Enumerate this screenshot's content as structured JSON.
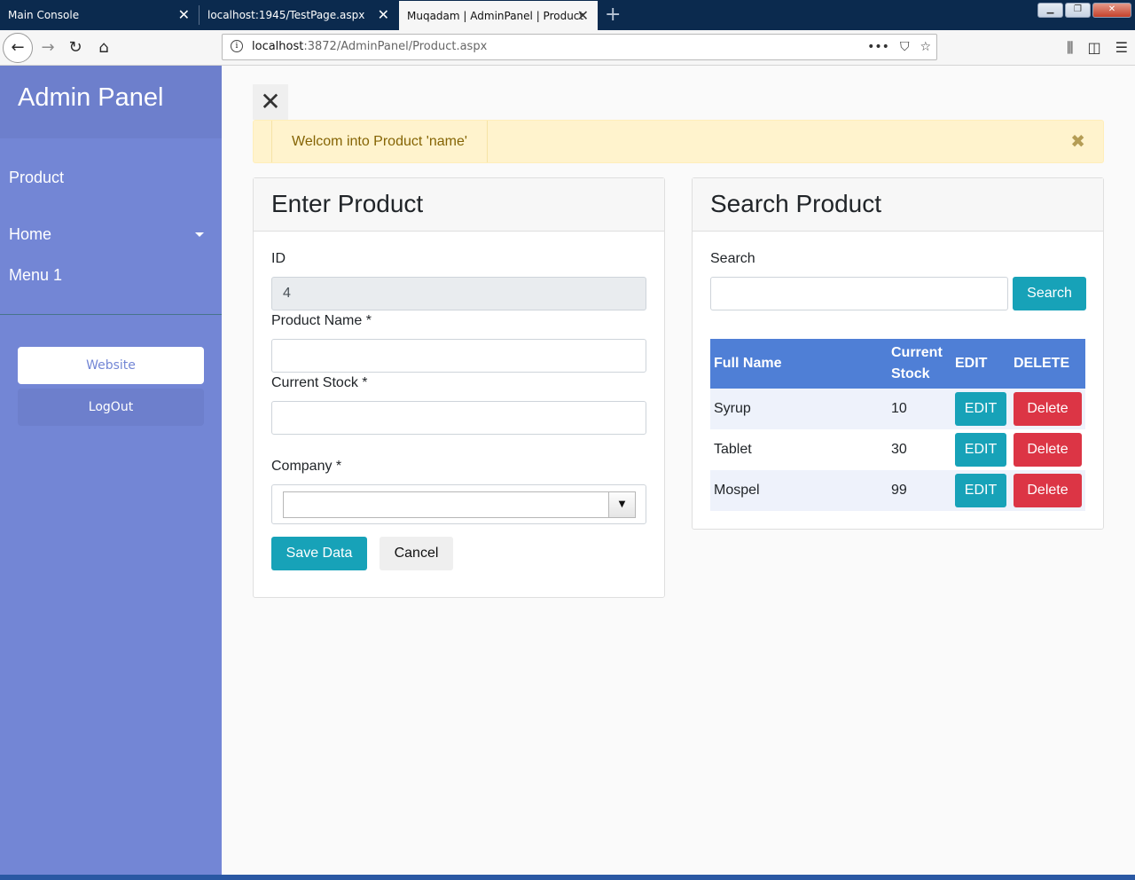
{
  "browser": {
    "tabs": [
      {
        "label": "Main Console"
      },
      {
        "label": "localhost:1945/TestPage.aspx"
      },
      {
        "label": "Muqadam | AdminPanel | Product"
      }
    ],
    "new_tab_icon": "+",
    "url_host": "localhost",
    "url_rest": ":3872/AdminPanel/Product.aspx",
    "url_actions": [
      "•••"
    ]
  },
  "sidebar": {
    "title": "Admin Panel",
    "items": [
      {
        "label": "Product"
      },
      {
        "label": "Home"
      },
      {
        "label": "Menu 1"
      }
    ],
    "website_label": "Website",
    "logout_label": "LogOut"
  },
  "alert": {
    "message": "Welcom into Product 'name'",
    "close_glyph": "✖"
  },
  "enter_product": {
    "title": "Enter Product",
    "id_label": "ID",
    "id_value": "4",
    "product_name_label": "Product Name *",
    "product_name_value": "",
    "current_stock_label": "Current Stock *",
    "current_stock_value": "",
    "company_label": "Company *",
    "company_value": "",
    "save_label": "Save Data",
    "cancel_label": "Cancel"
  },
  "search_product": {
    "title": "Search Product",
    "search_label": "Search",
    "search_value": "",
    "search_button": "Search",
    "columns": [
      "Full Name",
      "Current Stock",
      "EDIT",
      "DELETE"
    ],
    "rows": [
      {
        "name": "Syrup",
        "stock": "10",
        "edit": "EDIT",
        "delete": "Delete"
      },
      {
        "name": "Tablet",
        "stock": "30",
        "edit": "EDIT",
        "delete": "Delete"
      },
      {
        "name": "Mospel",
        "stock": "99",
        "edit": "EDIT",
        "delete": "Delete"
      }
    ]
  },
  "colors": {
    "sidebar": "#7386d5",
    "primary": "#17a2b8",
    "danger": "#dc3545",
    "table_header": "#4f7fd6",
    "alert_bg": "#fff3cd"
  }
}
